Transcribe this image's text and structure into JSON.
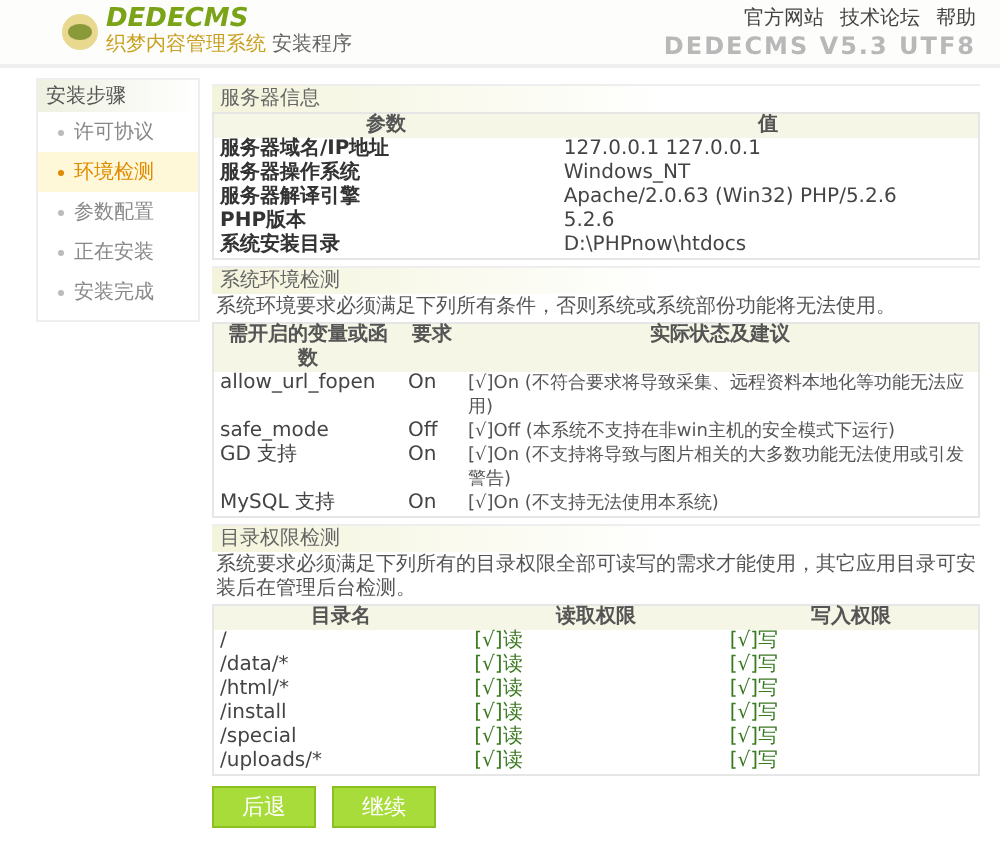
{
  "header": {
    "logo": "DEDECMS",
    "subtitle": "织梦内容管理系统",
    "subtitle_suffix": "安装程序",
    "links": [
      "官方网站",
      "技术论坛",
      "帮助"
    ],
    "version_banner": "DEDECMS V5.3 UTF8"
  },
  "sidebar": {
    "title": "安装步骤",
    "items": [
      {
        "label": "许可协议",
        "selected": false
      },
      {
        "label": "环境检测",
        "selected": true
      },
      {
        "label": "参数配置",
        "selected": false
      },
      {
        "label": "正在安装",
        "selected": false
      },
      {
        "label": "安装完成",
        "selected": false
      }
    ]
  },
  "server_info": {
    "title": "服务器信息",
    "columns": [
      "参数",
      "值"
    ],
    "rows": [
      [
        "服务器域名/IP地址",
        "127.0.0.1 127.0.0.1"
      ],
      [
        "服务器操作系统",
        "Windows_NT"
      ],
      [
        "服务器解译引擎",
        "Apache/2.0.63 (Win32) PHP/5.2.6"
      ],
      [
        "PHP版本",
        "5.2.6"
      ],
      [
        "系统安装目录",
        "D:\\PHPnow\\htdocs"
      ]
    ]
  },
  "env_check": {
    "title": "系统环境检测",
    "description": "系统环境要求必须满足下列所有条件，否则系统或系统部份功能将无法使用。",
    "columns": [
      "需开启的变量或函数",
      "要求",
      "实际状态及建议"
    ],
    "rows": [
      [
        "allow_url_fopen",
        "On",
        "[√]On (不符合要求将导致采集、远程资料本地化等功能无法应用)"
      ],
      [
        "safe_mode",
        "Off",
        "[√]Off (本系统不支持在非win主机的安全模式下运行)"
      ],
      [
        "GD 支持",
        "On",
        "[√]On (不支持将导致与图片相关的大多数功能无法使用或引发警告)"
      ],
      [
        "MySQL 支持",
        "On",
        "[√]On (不支持无法使用本系统)"
      ]
    ]
  },
  "dir_check": {
    "title": "目录权限检测",
    "description": "系统要求必须满足下列所有的目录权限全部可读写的需求才能使用，其它应用目录可安装后在管理后台检测。",
    "columns": [
      "目录名",
      "读取权限",
      "写入权限"
    ],
    "rows": [
      [
        "/",
        "[√]读",
        "[√]写"
      ],
      [
        "/data/*",
        "[√]读",
        "[√]写"
      ],
      [
        "/html/*",
        "[√]读",
        "[√]写"
      ],
      [
        "/install",
        "[√]读",
        "[√]写"
      ],
      [
        "/special",
        "[√]读",
        "[√]写"
      ],
      [
        "/uploads/*",
        "[√]读",
        "[√]写"
      ]
    ]
  },
  "buttons": [
    "后退",
    "继续"
  ]
}
